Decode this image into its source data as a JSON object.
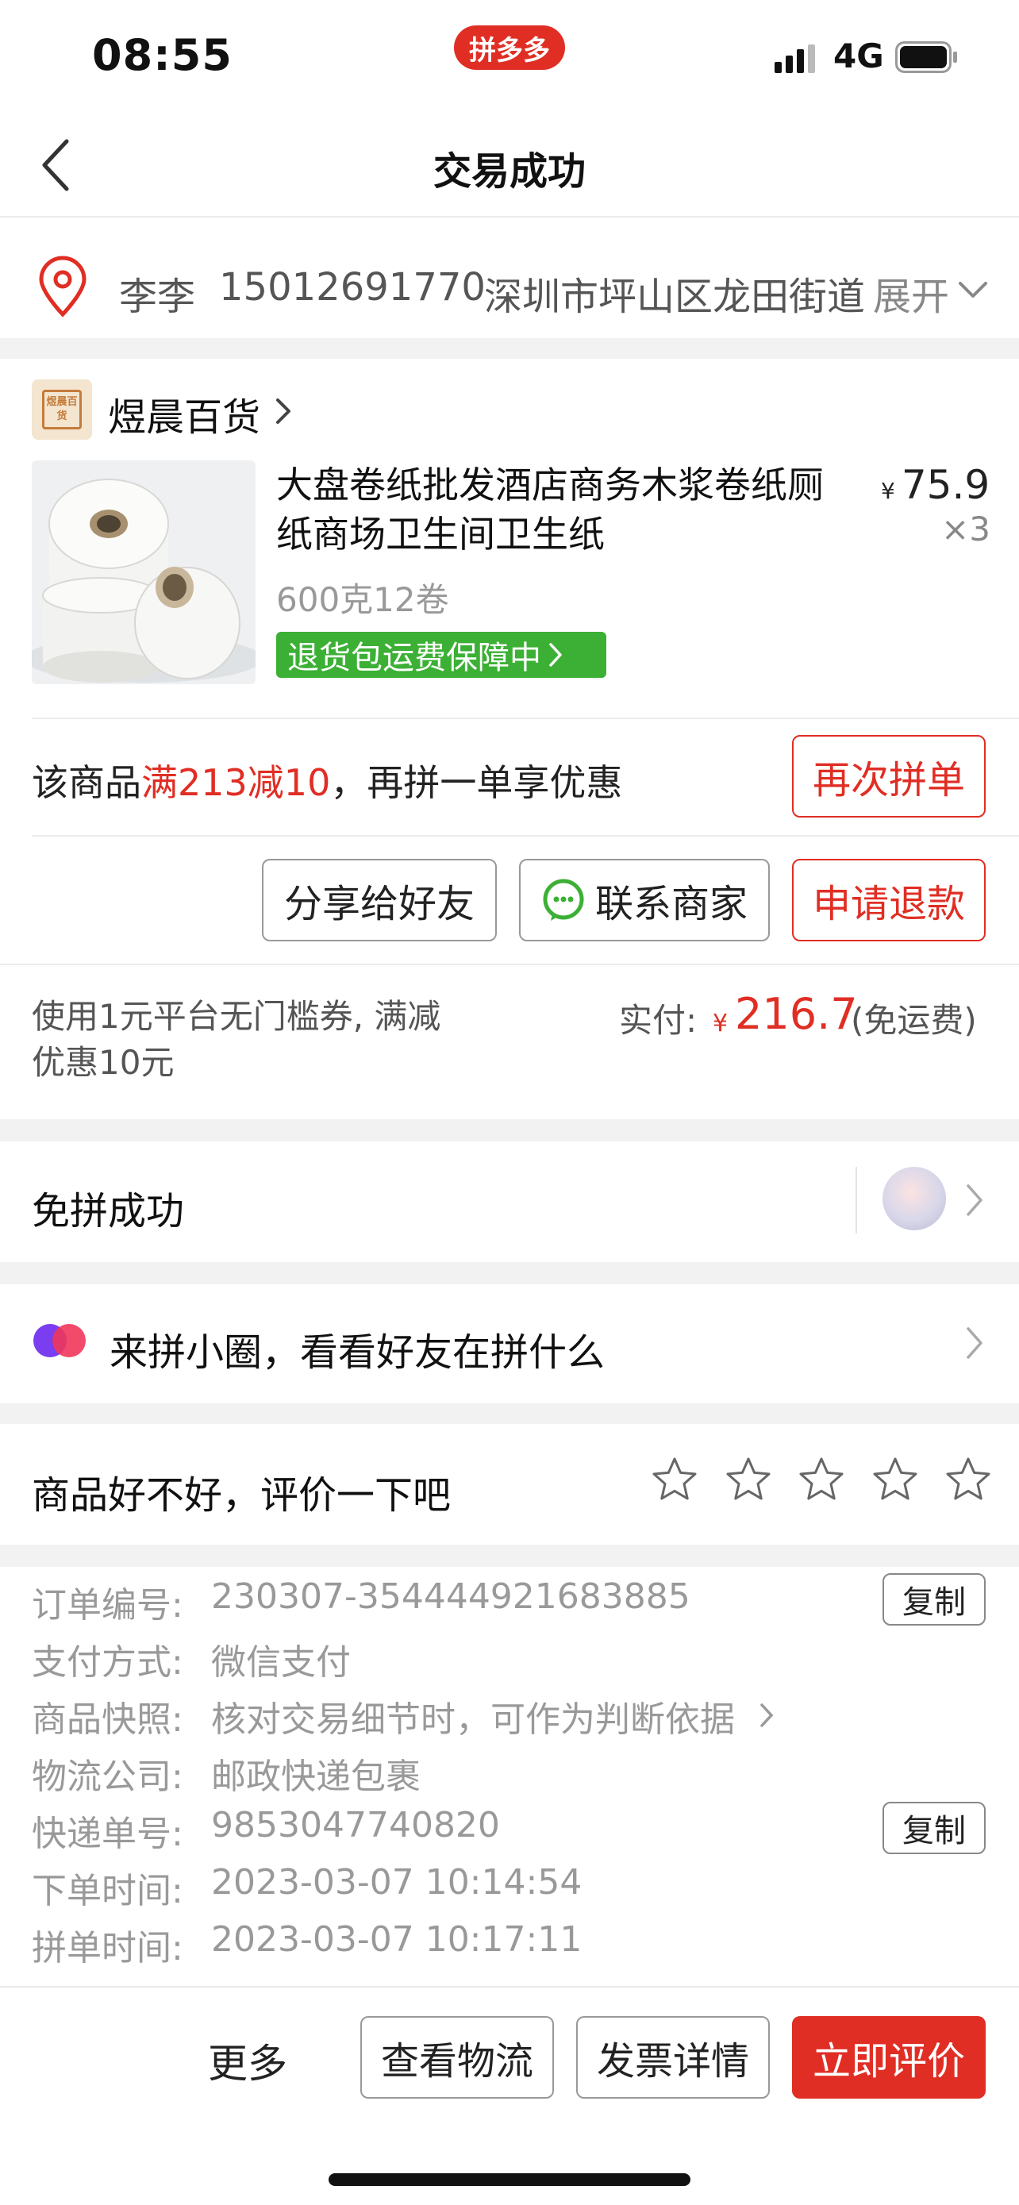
{
  "status_bar": {
    "time": "08:55",
    "app_badge": "拼多多",
    "network": "4G",
    "icons": [
      "signal-icon",
      "battery-icon"
    ]
  },
  "nav": {
    "title": "交易成功",
    "back_icon": "chevron-left-icon"
  },
  "address": {
    "name": "李李",
    "phone": "15012691770",
    "text": "深圳市坪山区龙田街道",
    "expand": "展开",
    "icon": "location-pin-icon"
  },
  "shop": {
    "logo_text": "煜晨百货",
    "name": "煜晨百货"
  },
  "product": {
    "title": "大盘卷纸批发酒店商务木浆卷纸厕纸商场卫生间卫生纸",
    "price_symbol": "¥",
    "price": "75.9",
    "quantity": "×3",
    "spec": "600克12卷",
    "badge": "退货包运费保障中"
  },
  "promo": {
    "prefix": "该商品",
    "highlight": "满213减10",
    "suffix": "，再拼一单享优惠",
    "reorder_button": "再次拼单"
  },
  "actions": {
    "share": "分享给好友",
    "contact": "联系商家",
    "refund": "申请退款"
  },
  "payment": {
    "coupon_note": "使用1元平台无门槛券, 满减优惠10元",
    "label": "实付:",
    "symbol": "¥",
    "amount": "216.7",
    "note": "(免运费)"
  },
  "group": {
    "title": "免拼成功"
  },
  "circle": {
    "title": "来拼小圈，看看好友在拼什么"
  },
  "review": {
    "prompt": "商品好不好，评价一下吧",
    "stars_total": 5,
    "stars_filled": 0
  },
  "order_info": {
    "rows": [
      {
        "label": "订单编号:",
        "value": "230307-354444921683885"
      },
      {
        "label": "支付方式:",
        "value": "微信支付"
      },
      {
        "label": "商品快照:",
        "value": "核对交易细节时，可作为判断依据"
      },
      {
        "label": "物流公司:",
        "value": "邮政快递包裹"
      },
      {
        "label": "快递单号:",
        "value": "9853047740820"
      },
      {
        "label": "下单时间:",
        "value": "2023-03-07 10:14:54"
      },
      {
        "label": "拼单时间:",
        "value": "2023-03-07 10:17:11"
      }
    ],
    "copy_label": "复制"
  },
  "bottom_bar": {
    "more": "更多",
    "logistics": "查看物流",
    "invoice": "发票详情",
    "review_now": "立即评价"
  },
  "colors": {
    "brand_red": "#e02e24",
    "badge_green": "#3cb035",
    "wechat_green": "#3cb035"
  }
}
